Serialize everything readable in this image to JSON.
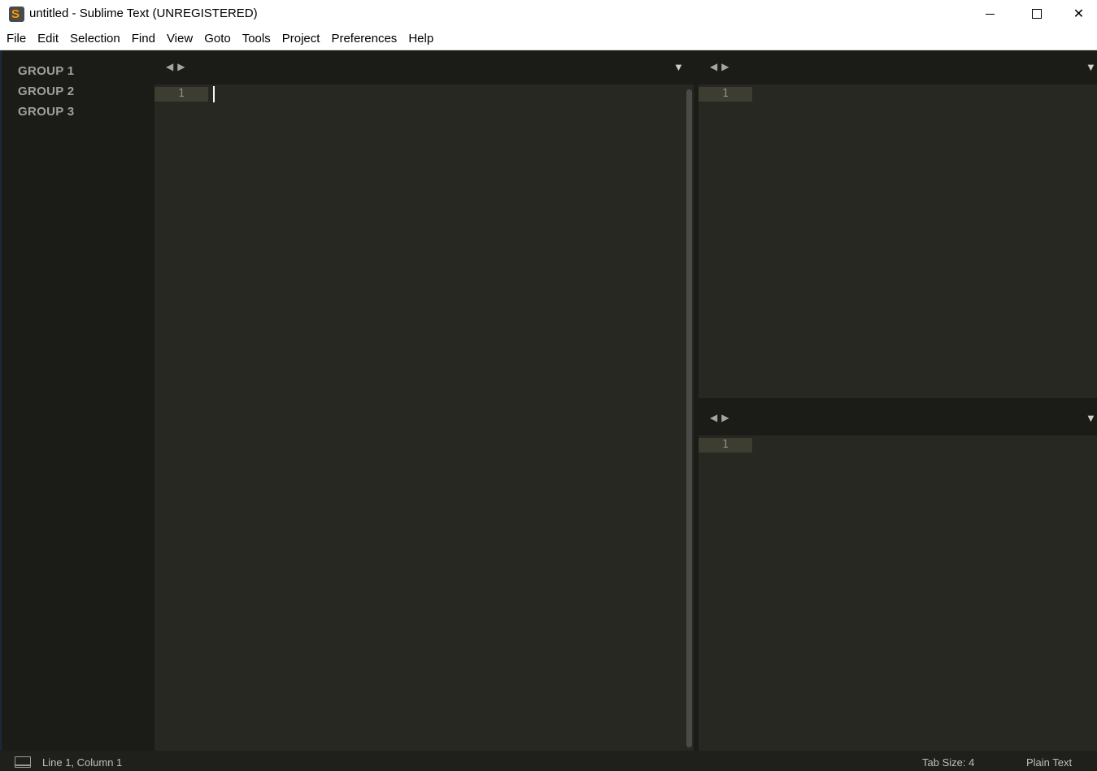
{
  "window": {
    "title": "untitled - Sublime Text (UNREGISTERED)",
    "app_icon_glyph": "S",
    "minimize": "minimize",
    "maximize": "maximize",
    "close_glyph": "✕"
  },
  "menu": [
    "File",
    "Edit",
    "Selection",
    "Find",
    "View",
    "Goto",
    "Tools",
    "Project",
    "Preferences",
    "Help"
  ],
  "sidebar": {
    "groups": [
      "GROUP 1",
      "GROUP 2",
      "GROUP 3"
    ]
  },
  "tabbar": {
    "left_arrow": "◀",
    "right_arrow": "▶",
    "dropdown": "▼"
  },
  "panes": [
    {
      "line_number": "1",
      "has_cursor": true
    },
    {
      "line_number": "1",
      "has_cursor": false
    },
    {
      "line_number": "1",
      "has_cursor": false
    }
  ],
  "status": {
    "position": "Line 1, Column 1",
    "tab_size": "Tab Size: 4",
    "syntax": "Plain Text"
  },
  "colors": {
    "editor_bg": "#272822",
    "sidebar_bg": "#1b1c17",
    "gutter_highlight": "#3e3d32",
    "brand": "#ff9800"
  }
}
